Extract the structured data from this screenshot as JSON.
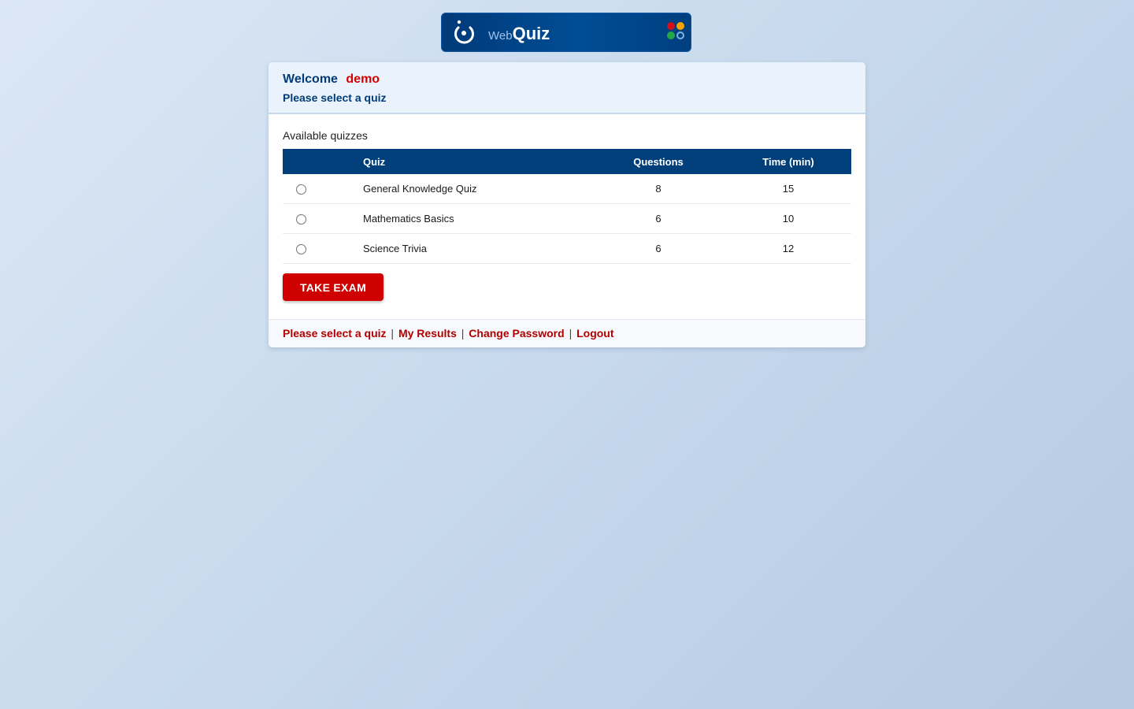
{
  "logo": {
    "text_web": "Web",
    "text_quiz": "Quiz"
  },
  "header": {
    "welcome_label": "Welcome",
    "username": "demo",
    "subtitle": "Please select a quiz"
  },
  "section_label": "Available quizzes",
  "table": {
    "columns": [
      "",
      "Quiz",
      "Questions",
      "Time (min)"
    ],
    "rows": [
      {
        "name": "General Knowledge Quiz",
        "questions": "8",
        "time": "15"
      },
      {
        "name": "Mathematics Basics",
        "questions": "6",
        "time": "10"
      },
      {
        "name": "Science Trivia",
        "questions": "6",
        "time": "12"
      }
    ]
  },
  "take_exam_label": "TAKE EXAM",
  "footer": {
    "links": [
      "Please select a quiz",
      "My Results",
      "Change Password",
      "Logout"
    ],
    "separator": "|"
  },
  "colors": {
    "brand_navy": "#003f7a",
    "accent_red": "#cf0000",
    "link_red": "#b20000"
  },
  "icons": {
    "logo_mark": "logo-mark-icon",
    "logo_dots": "color-dots-icon",
    "radio": "radio-button-icon"
  }
}
